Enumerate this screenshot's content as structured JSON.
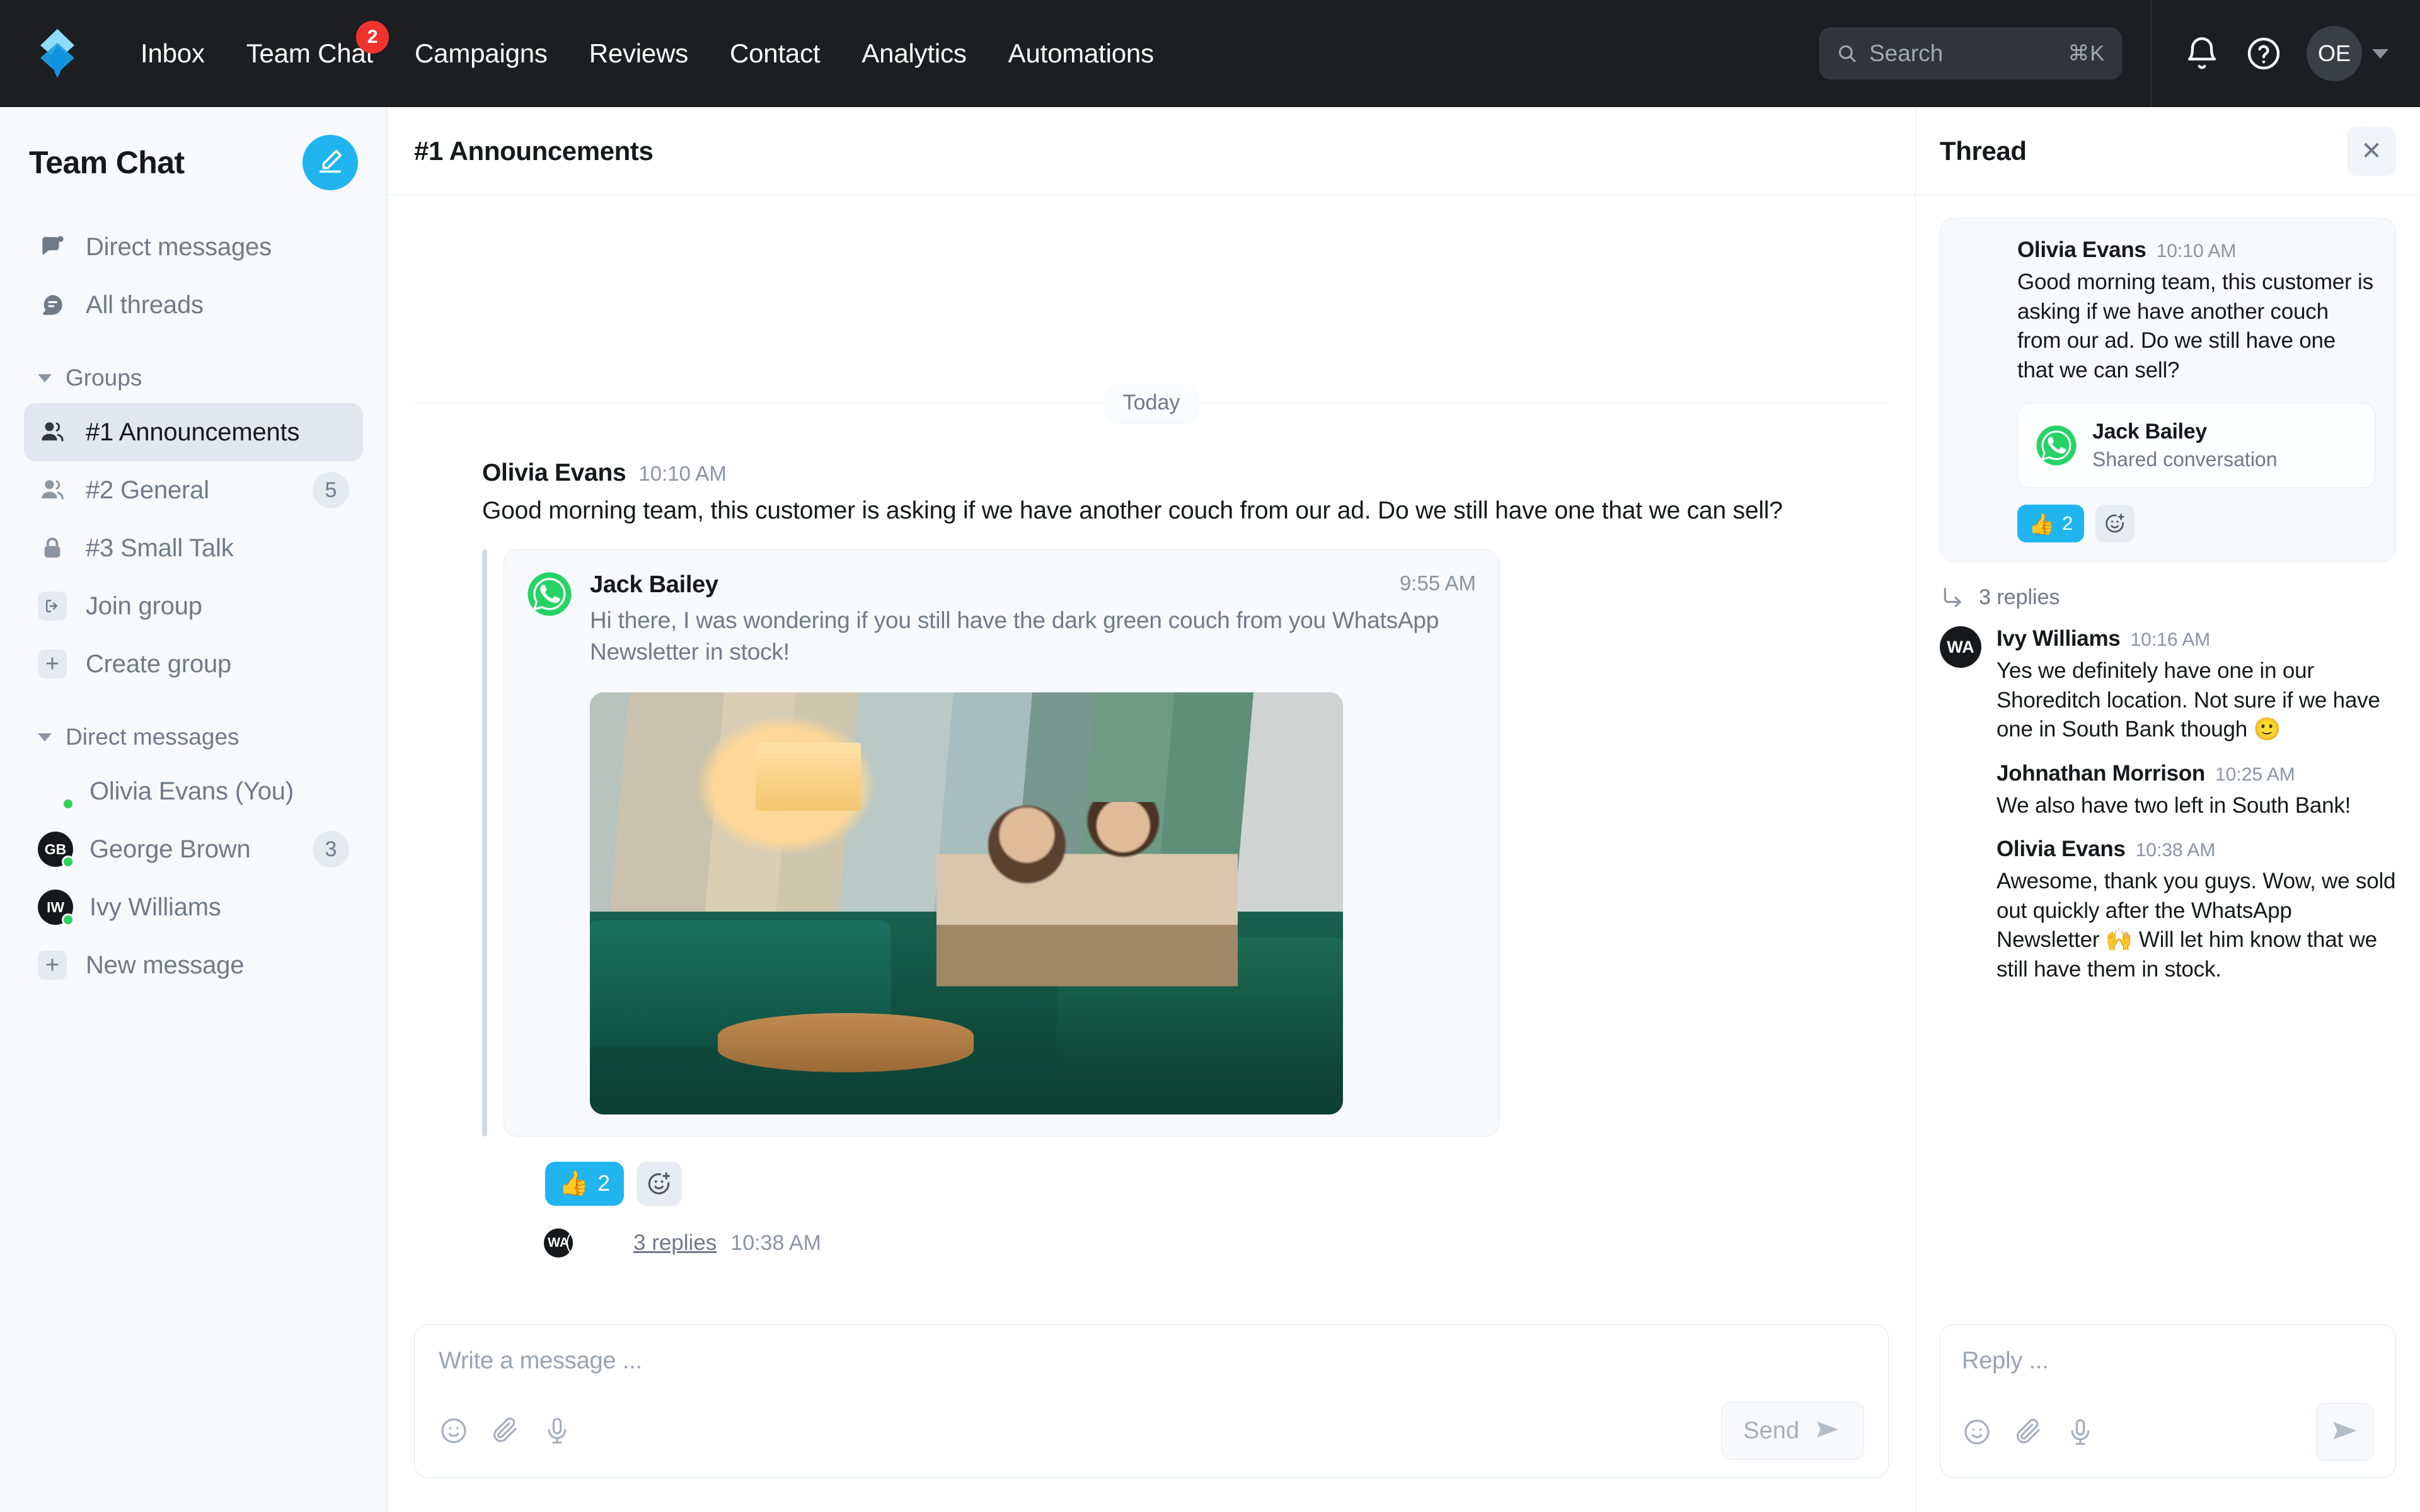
{
  "topnav": {
    "logo_name": "superchat-logo",
    "items": [
      {
        "label": "Inbox",
        "badge": null
      },
      {
        "label": "Team Chat",
        "badge": "2"
      },
      {
        "label": "Campaigns",
        "badge": null
      },
      {
        "label": "Reviews",
        "badge": null
      },
      {
        "label": "Contact",
        "badge": null
      },
      {
        "label": "Analytics",
        "badge": null
      },
      {
        "label": "Automations",
        "badge": null
      }
    ],
    "search": {
      "placeholder": "Search",
      "shortcut": "⌘K"
    },
    "notifications_icon": "bell-icon",
    "help_icon": "help-circle-icon",
    "avatar_initials": "OE"
  },
  "sidebar": {
    "title": "Team Chat",
    "compose_icon": "compose-pencil-icon",
    "top_items": [
      {
        "label": "Direct messages",
        "icon": "chat-bubble-icon"
      },
      {
        "label": "All threads",
        "icon": "threads-icon"
      }
    ],
    "groups_section": {
      "label": "Groups"
    },
    "groups": [
      {
        "label": "#1 Announcements",
        "icon": "people-icon",
        "count": null,
        "active": true
      },
      {
        "label": "#2 General",
        "icon": "people-icon",
        "count": "5",
        "active": false
      },
      {
        "label": "#3 Small Talk",
        "icon": "lock-icon",
        "count": null,
        "active": false
      },
      {
        "label": "Join group",
        "icon": "join-icon",
        "count": null,
        "active": false
      },
      {
        "label": "Create group",
        "icon": "plus-icon",
        "count": null,
        "active": false
      }
    ],
    "dm_section": {
      "label": "Direct messages"
    },
    "dms": [
      {
        "label": "Olivia Evans (You)",
        "avatar": "photo-olivia",
        "initials": null,
        "count": null,
        "online": true
      },
      {
        "label": "George Brown",
        "avatar": "initials",
        "initials": "GB",
        "count": "3",
        "online": true
      },
      {
        "label": "Ivy Williams",
        "avatar": "initials",
        "initials": "IW",
        "count": null,
        "online": true
      },
      {
        "label": "New message",
        "avatar": "plus",
        "initials": null,
        "count": null,
        "online": false
      }
    ]
  },
  "channel": {
    "title": "#1 Announcements",
    "day_divider": "Today",
    "message": {
      "author": "Olivia Evans",
      "time": "10:10 AM",
      "text": "Good morning team, this customer is asking if we have another couch from our ad. Do we still have one that we can sell?",
      "quote": {
        "name": "Jack Bailey",
        "time": "9:55 AM",
        "text": "Hi there, I was wondering if you still have the dark green couch from you WhatsApp Newsletter in stock!",
        "channel_icon": "whatsapp-icon",
        "image_alt": "couple-on-green-couch-photo"
      },
      "reaction": {
        "emoji": "👍",
        "count": "2",
        "add_icon": "add-reaction-icon"
      },
      "replies_link": "3 replies",
      "replies_time": "10:38 AM",
      "reply_avatars": [
        "WA",
        "photo-john",
        "photo-olivia"
      ]
    },
    "composer": {
      "placeholder": "Write a message ...",
      "emoji_icon": "emoji-icon",
      "attach_icon": "paperclip-icon",
      "mic_icon": "microphone-icon",
      "send_label": "Send",
      "send_icon": "send-icon"
    }
  },
  "thread": {
    "title": "Thread",
    "close_icon": "close-icon",
    "root": {
      "author": "Olivia Evans",
      "time": "10:10 AM",
      "text": "Good morning team, this customer is asking if we have another couch from our ad. Do we still have one that we can sell?",
      "shared": {
        "name": "Jack Bailey",
        "subtitle": "Shared conversation",
        "channel_icon": "whatsapp-icon"
      },
      "reaction": {
        "emoji": "👍",
        "count": "2",
        "add_icon": "add-reaction-icon"
      }
    },
    "replies_header": {
      "label": "3 replies",
      "icon": "reply-arrow-icon"
    },
    "replies": [
      {
        "author": "Ivy Williams",
        "time": "10:16 AM",
        "text": "Yes we definitely have one in our Shoreditch location. Not sure if we have one in South Bank though 🙂",
        "avatar": "initials",
        "initials": "WA"
      },
      {
        "author": "Johnathan Morrison",
        "time": "10:25 AM",
        "text": "We also have two left in South Bank!",
        "avatar": "photo-john",
        "initials": null
      },
      {
        "author": "Olivia Evans",
        "time": "10:38 AM",
        "text": "Awesome, thank you guys. Wow, we sold out quickly after the WhatsApp Newsletter 🙌 Will let him know that we still have them in stock.",
        "avatar": "photo-olivia",
        "initials": null
      }
    ],
    "composer": {
      "placeholder": "Reply ...",
      "emoji_icon": "emoji-icon",
      "attach_icon": "paperclip-icon",
      "mic_icon": "microphone-icon",
      "send_icon": "send-icon"
    }
  },
  "colors": {
    "accent": "#21b5f0",
    "topbar_bg": "#1c1e21",
    "badge_red": "#f0322e",
    "whatsapp_green": "#25d366",
    "online_green": "#2fd15c"
  }
}
